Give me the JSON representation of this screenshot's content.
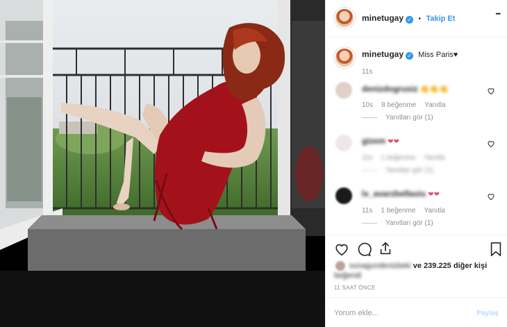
{
  "header": {
    "username": "minetugay",
    "separator": "•",
    "follow_label": "Takip Et",
    "more_label": "•••"
  },
  "caption": {
    "username": "minetugay",
    "text": "Miss Paris♥",
    "time": "11s"
  },
  "comments": [
    {
      "username": "denizdogrusiz",
      "text": "👏👏👏",
      "time": "10s",
      "likes": "8 beğenme",
      "reply": "Yanıtla",
      "view_replies": "Yanıtları gör (1)",
      "blurred_meta": false
    },
    {
      "username": "gizem",
      "text": "❤❤",
      "time": "11s",
      "likes": "1 beğenme",
      "reply": "Yanıtla",
      "view_replies": "Yanıtları gör (1)",
      "blurred_meta": true
    },
    {
      "username": "lx_avarzbellasiu",
      "text": "❤❤",
      "time": "11s",
      "likes": "1 beğenme",
      "reply": "Yanıtla",
      "view_replies": "Yanıtları gör (1)",
      "blurred_meta": false
    }
  ],
  "likes": {
    "liker": "sunagundenizbeki",
    "others": "ve 239.225 diğer kişi",
    "liked": "beğendi"
  },
  "timestamp": "11 SAAT ÖNCE",
  "comment_box": {
    "placeholder": "Yorum ekle...",
    "post_label": "Paylaş"
  },
  "colors": {
    "link_blue": "#3897f0",
    "secondary_text": "#8e8e8e",
    "dress_red": "#a3121b"
  }
}
